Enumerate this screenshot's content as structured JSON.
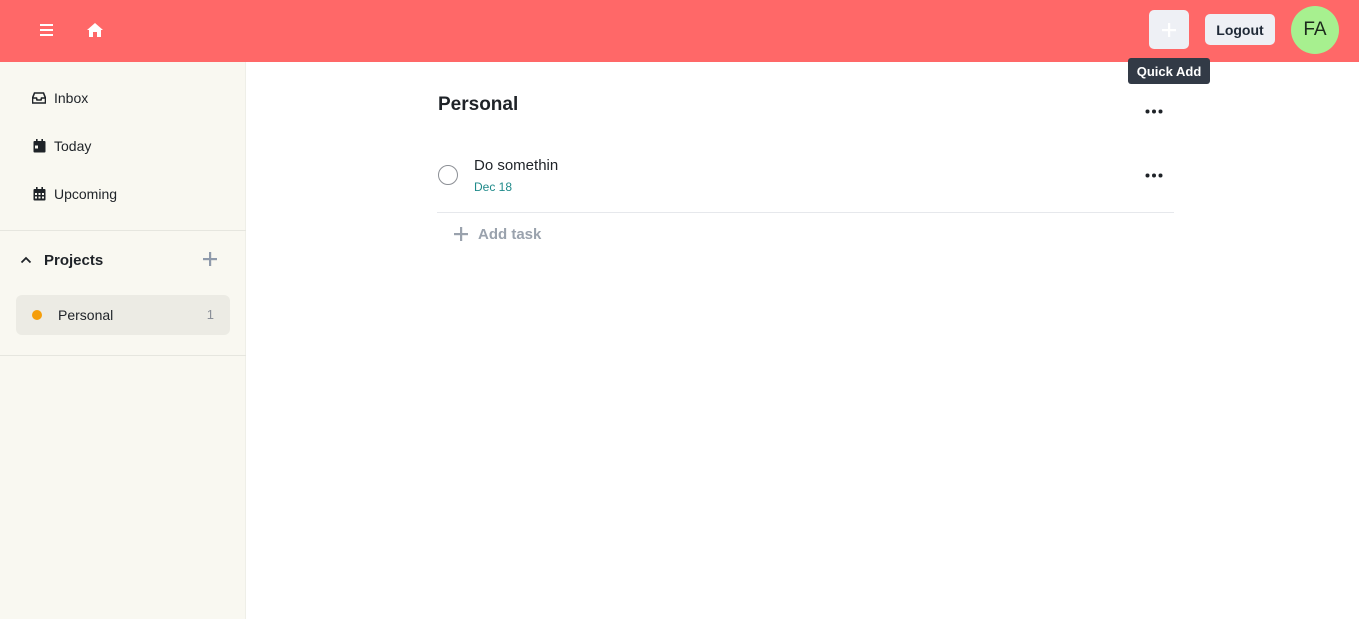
{
  "header": {
    "quick_add_tooltip": "Quick Add",
    "logout_label": "Logout",
    "avatar_initials": "FA"
  },
  "sidebar": {
    "nav": [
      {
        "label": "Inbox",
        "icon": "inbox-icon"
      },
      {
        "label": "Today",
        "icon": "calendar-day-icon"
      },
      {
        "label": "Upcoming",
        "icon": "calendar-icon"
      }
    ],
    "projects_label": "Projects",
    "projects": [
      {
        "name": "Personal",
        "count": "1",
        "color": "#f59e0b"
      }
    ]
  },
  "main": {
    "title": "Personal",
    "tasks": [
      {
        "title": "Do somethin",
        "due": "Dec 18"
      }
    ],
    "add_task_label": "Add task"
  },
  "colors": {
    "header_bg": "#ff6868",
    "sidebar_bg": "#f9f8f1",
    "avatar_bg": "#a7f08f",
    "due_color": "#1f8a8a"
  }
}
